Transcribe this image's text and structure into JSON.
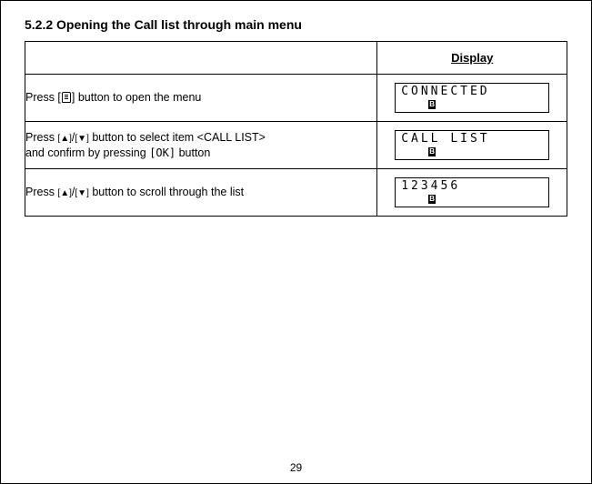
{
  "heading": "5.2.2  Opening the Call list through main menu",
  "table": {
    "display_header": "Display",
    "rows": [
      {
        "action_pre": "Press [",
        "action_icon": "menu-icon",
        "action_post": "] button to open the menu",
        "lcd_text": "CONNECTED"
      },
      {
        "action_line1_pre": "Press ",
        "up": "[▲]",
        "slash1": "/",
        "down": "[▼]",
        "action_line1_post": " button to select item <CALL LIST>",
        "action_line2_pre": "and confirm by pressing ",
        "ok": "[OK]",
        "action_line2_post": " button",
        "lcd_text": "CALL  LIST"
      },
      {
        "action_pre2": "Press ",
        "up2": "[▲]",
        "slash2": "/",
        "down2": "[▼]",
        "action_post2": " button to scroll through the list",
        "lcd_text": "123456"
      }
    ]
  },
  "page_number": "29"
}
